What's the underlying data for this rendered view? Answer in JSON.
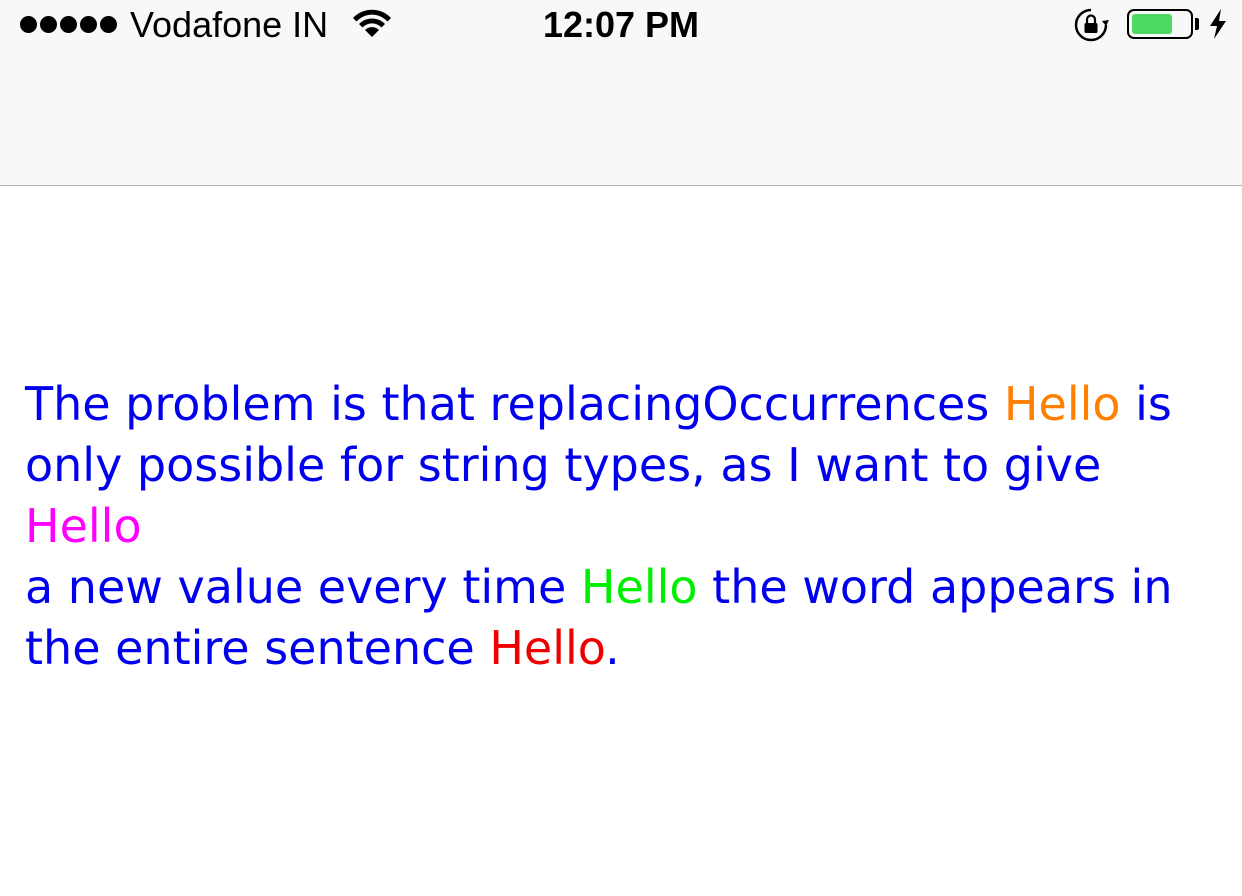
{
  "status_bar": {
    "signal_bars": 5,
    "carrier": "Vodafone IN",
    "wifi_icon": "wifi-icon",
    "time": "12:07 PM",
    "rotation_lock_icon": "rotation-lock-icon",
    "battery_level": 0.72,
    "battery_color": "#4cd964",
    "charging_icon": "bolt-icon"
  },
  "nav_bar": {
    "background": "#f8f8f8"
  },
  "label": {
    "base_color": "#0000ee",
    "segments": [
      {
        "text": "The problem is that replacingOccurrences ",
        "highlight": false
      },
      {
        "text": "Hello",
        "highlight": true,
        "color": "#ff7f00"
      },
      {
        "text": " is\nonly possible for string types, as I want to give ",
        "highlight": false
      },
      {
        "text": "Hello",
        "highlight": true,
        "color": "#ff00ff"
      },
      {
        "text": "\na new value every time ",
        "highlight": false
      },
      {
        "text": "Hello",
        "highlight": true,
        "color": "#00ee00"
      },
      {
        "text": " the word appears in\nthe entire sentence ",
        "highlight": false
      },
      {
        "text": "Hello",
        "highlight": true,
        "color": "#ee0000"
      },
      {
        "text": ".",
        "highlight": false
      }
    ]
  }
}
